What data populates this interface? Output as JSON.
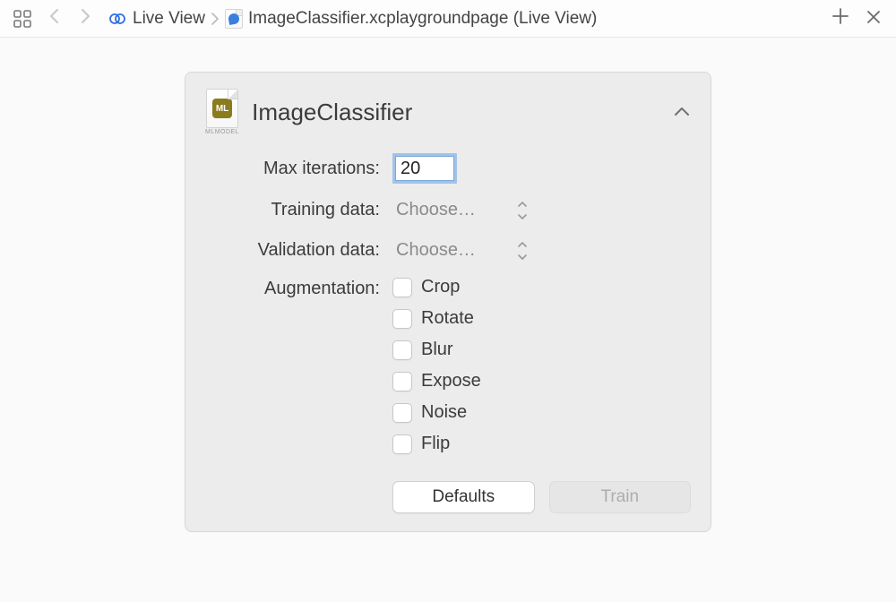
{
  "breadcrumb": {
    "item1": "Live View",
    "item2": "ImageClassifier.xcplaygroundpage (Live View)"
  },
  "panel": {
    "title": "ImageClassifier",
    "mlmodel_caption": "MLMODEL",
    "ml_badge": "ML"
  },
  "fields": {
    "max_iterations": {
      "label": "Max iterations:",
      "value": "20"
    },
    "training_data": {
      "label": "Training data:",
      "value": "Choose…"
    },
    "validation_data": {
      "label": "Validation data:",
      "value": "Choose…"
    },
    "augmentation": {
      "label": "Augmentation:",
      "options": [
        "Crop",
        "Rotate",
        "Blur",
        "Expose",
        "Noise",
        "Flip"
      ]
    }
  },
  "buttons": {
    "defaults": "Defaults",
    "train": "Train"
  }
}
